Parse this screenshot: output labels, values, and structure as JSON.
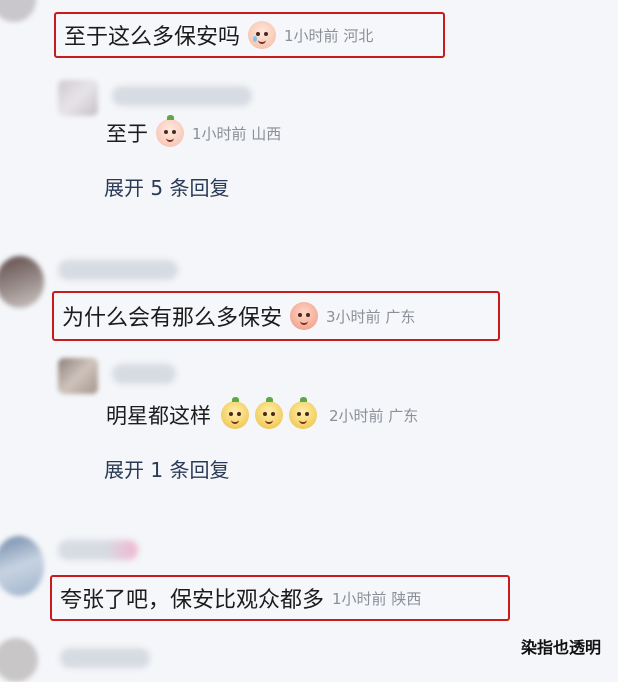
{
  "comments": [
    {
      "text": "至于这么多保安吗",
      "emoji": "crying-face-icon",
      "meta": "1小时前 河北",
      "replies": [
        {
          "text": "至于",
          "emoji": "shy-face-icon",
          "meta": "1小时前 山西"
        }
      ],
      "expand_label": "展开 5 条回复"
    },
    {
      "text": "为什么会有那么多保安",
      "emoji": "angry-face-icon",
      "meta": "3小时前 广东",
      "replies": [
        {
          "text": "明星都这样",
          "emoji": "laughing-face-icon",
          "meta": "2小时前 广东"
        }
      ],
      "expand_label": "展开 1 条回复"
    },
    {
      "text": "夸张了吧，保安比观众都多",
      "meta": "1小时前 陕西"
    }
  ],
  "watermark": "染指也透明",
  "colors": {
    "highlight_border": "#c91b1b",
    "meta_gray": "#8a8f98",
    "expand_blue": "#2b3a55"
  }
}
